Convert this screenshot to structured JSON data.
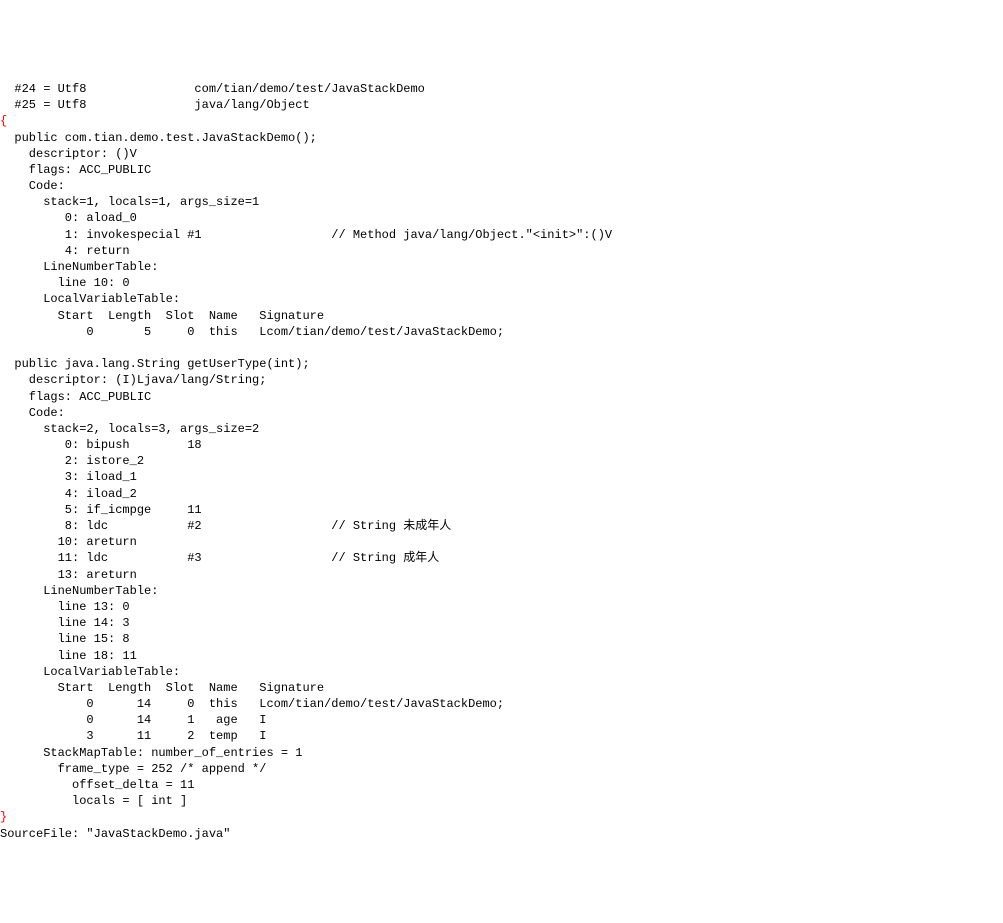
{
  "header": {
    "line1": "  #24 = Utf8               com/tian/demo/test/JavaStackDemo",
    "line2": "  #25 = Utf8               java/lang/Object"
  },
  "method1": {
    "signature": "  public com.tian.demo.test.JavaStackDemo();",
    "descriptor": "    descriptor: ()V",
    "flags": "    flags: ACC_PUBLIC",
    "code_label": "    Code:",
    "stack": "      stack=1, locals=1, args_size=1",
    "instr0": "         0: aload_0",
    "instr1": "         1: invokespecial #1                  // Method java/lang/Object.\"<init>\":()V",
    "instr4": "         4: return",
    "lnt_label": "      LineNumberTable:",
    "lnt0": "        line 10: 0",
    "lvt_label": "      LocalVariableTable:",
    "lvt_header": "        Start  Length  Slot  Name   Signature",
    "lvt0": "            0       5     0  this   Lcom/tian/demo/test/JavaStackDemo;"
  },
  "method2": {
    "signature": "  public java.lang.String getUserType(int);",
    "descriptor": "    descriptor: (I)Ljava/lang/String;",
    "flags": "    flags: ACC_PUBLIC",
    "code_label": "    Code:",
    "stack": "      stack=2, locals=3, args_size=2",
    "instr0": "         0: bipush        18",
    "instr2": "         2: istore_2",
    "instr3": "         3: iload_1",
    "instr4": "         4: iload_2",
    "instr5": "         5: if_icmpge     11",
    "instr8": "         8: ldc           #2                  // String 未成年人",
    "instr10": "        10: areturn",
    "instr11": "        11: ldc           #3                  // String 成年人",
    "instr13": "        13: areturn",
    "lnt_label": "      LineNumberTable:",
    "lnt0": "        line 13: 0",
    "lnt1": "        line 14: 3",
    "lnt2": "        line 15: 8",
    "lnt3": "        line 18: 11",
    "lvt_label": "      LocalVariableTable:",
    "lvt_header": "        Start  Length  Slot  Name   Signature",
    "lvt0": "            0      14     0  this   Lcom/tian/demo/test/JavaStackDemo;",
    "lvt1": "            0      14     1   age   I",
    "lvt2": "            3      11     2  temp   I",
    "smt_label": "      StackMapTable: number_of_entries = 1",
    "smt0": "        frame_type = 252 /* append */",
    "smt1": "          offset_delta = 11",
    "smt2": "          locals = [ int ]"
  },
  "footer": {
    "source": "SourceFile: \"JavaStackDemo.java\""
  },
  "braces": {
    "open": "{",
    "close": "}"
  }
}
